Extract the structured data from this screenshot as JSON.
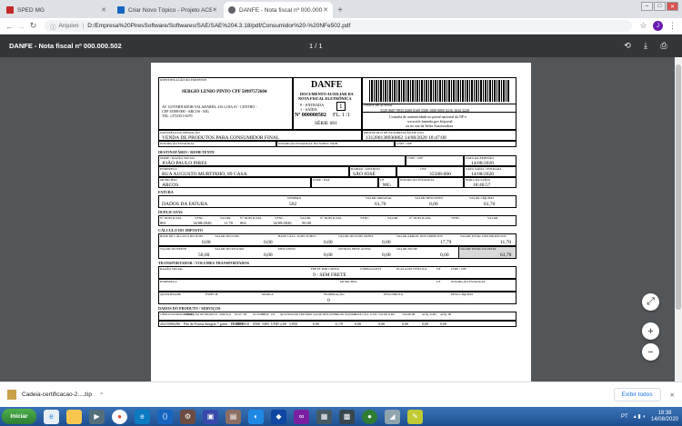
{
  "browser": {
    "tabs": [
      {
        "label": "SPED MG",
        "color": "#c62828",
        "active": false
      },
      {
        "label": "Criar Novo Tópico - Projeto ACBr",
        "color": "#1565c0",
        "active": false
      },
      {
        "label": "DANFE - Nota fiscal nº 000.000.502",
        "color": "#5f6368",
        "active": true
      }
    ],
    "new_tab": "+",
    "url_prefix": "Arquivo",
    "url": "D:/Empresa%20PiresSoftware/Softwares/SAE/SAE%204.3.18/pdf/Consumidor%20-%20NFe502.pdf",
    "avatar_letter": "J"
  },
  "pdf": {
    "title": "DANFE - Nota fiscal nº 000.000.502",
    "page_indicator": "1 / 1"
  },
  "danfe": {
    "recebemos": "IDENTIFICAÇÃO DO EMITENTE",
    "emitente_nome": "SERGIO LENIO PINTO CPF 50997572604",
    "emitente_end1": "AV. GOVERNADOR VALADARES, 416 LOJA 01 - CENTRO -",
    "emitente_end2": "CEP 35588-000 - ARCOS - MG",
    "emitente_tel": "TEL: (37)3351-6379",
    "danfe_title": "DANFE",
    "danfe_sub1": "DOCUMENTO AUXILIAR DA",
    "danfe_sub2": "NOTA FISCAL ELETRÔNICA",
    "entrada": "0 - ENTRADA",
    "saida": "1 - SAÍDA",
    "tipo": "1",
    "numero": "Nº 000000502",
    "folha": "FL. 1 /1",
    "serie": "SÉRIE 001",
    "chave_label": "CHAVE DE ACESSO",
    "chave": "3120 0607 9933 0200 0169 5500 1000 0005 0216 1634 3228",
    "consulta1": "Consulta de autenticidade no portal nacional da NF-e",
    "consulta2": "www.nfe.fazenda.gov.br/portal",
    "consulta3": "ou no site da Sefaz Autorizadora",
    "natureza_label": "NATUREZA DA OPERAÇÃO",
    "natureza": "VENDA DE PRODUTOS PARA CONSUMIDOR FINAL",
    "protocolo_label": "PROTOCOLO DE AUTORIZAÇÃO DE USO",
    "protocolo": "131200138930862 14/08/2020 18:47:00",
    "ie_label": "INSCRIÇÃO ESTADUAL",
    "ie_st_label": "INSCRIÇÃO ESTADUAL DO SUBST. TRIB.",
    "cnpj_label": "CNPJ / CPF",
    "dest_section": "DESTINATÁRIO / REMETENTE",
    "dest_nome_label": "NOME / RAZÃO SOCIAL",
    "dest_nome": "JOÃO PAULO PIRES",
    "dest_cnpj_label": "CNPJ / CPF",
    "dest_emissao_label": "DATA DA EMISSÃO",
    "dest_emissao": "14/08/2020",
    "dest_end_label": "ENDEREÇO",
    "dest_end": "RUA AUGUSTO MURTINHO, 89 CASA",
    "dest_bairro_label": "BAIRRO / DISTRITO",
    "dest_bairro": "SÃO JOSÉ",
    "dest_cep_label": "CEP",
    "dest_cep": "35588-000",
    "dest_saida_label": "DATA SAÍDA / ENTRADA",
    "dest_saida": "14/08/2020",
    "dest_mun_label": "MUNICÍPIO",
    "dest_mun": "ARCOS",
    "dest_fone_label": "FONE / FAX",
    "dest_uf_label": "UF",
    "dest_uf": "MG",
    "dest_ie_label": "INSCRIÇÃO ESTADUAL",
    "dest_hora_label": "HORA DA SAÍDA",
    "dest_hora": "18:46:57",
    "fatura_section": "FATURA",
    "fat_headers": [
      "NÚMERO",
      "VALOR ORIGINAL",
      "VALOR DESCONTO",
      "VALOR LÍQUIDO"
    ],
    "fat_desc": "DADOS DA FATURA",
    "fat_values": [
      "502",
      "61,70",
      "0,00",
      "61,70"
    ],
    "dup_section": "DUPLICATAS",
    "dup_headers": [
      "Nº DUPLICATA",
      "VENC.",
      "VALOR",
      "Nº DUPLICATA",
      "VENC.",
      "VALOR",
      "Nº DUPLICATA",
      "VENC.",
      "VALOR",
      "Nº DUPLICATA",
      "VENC.",
      "VALOR"
    ],
    "dup_values": [
      "001",
      "14/08/2020",
      "11,70",
      "002",
      "14/09/2020",
      "50,00"
    ],
    "imposto_section": "CÁLCULO DO IMPOSTO",
    "imp_headers1": [
      "BASE DE CÁLCULO DO ICMS",
      "VALOR DO ICMS",
      "BASE CÁLC. ICMS SUBST.",
      "VALOR DO ICMS SUBST.",
      "VALOR APROX. DOS TRIBUTOS",
      "VALOR TOTAL DOS PRODUTOS"
    ],
    "imp_values1": [
      "0,00",
      "0,00",
      "0,00",
      "0,00",
      "17,79",
      "11,70"
    ],
    "imp_headers2": [
      "VALOR DO FRETE",
      "VALOR DO SEGURO",
      "DESCONTO",
      "OUTRAS DESP. ACESS.",
      "VALOR DO IPI",
      "VALOR TOTAL DA NOTA"
    ],
    "imp_values2": [
      "50,00",
      "0,00",
      "0,00",
      "0,00",
      "0,00",
      "61,70"
    ],
    "transp_section": "TRANSPORTADOR / VOLUMES TRANSPORTADOS",
    "transp_headers": [
      "RAZÃO SOCIAL",
      "FRETE POR CONTA",
      "CÓDIGO ANTT",
      "PLACA DO VEÍCULO",
      "UF",
      "CNPJ / CPF"
    ],
    "transp_frete": "9 - SEM FRETE",
    "transp_row2": [
      "ENDEREÇO",
      "MUNICÍPIO",
      "UF",
      "INSCRIÇÃO ESTADUAL"
    ],
    "transp_row3": [
      "QUANTIDADE",
      "ESPÉCIE",
      "MARCA",
      "NUMERAÇÃO",
      "PESO BRUTO",
      "PESO LÍQUIDO"
    ],
    "transp_num": "0",
    "prod_section": "DADOS DO PRODUTO / SERVIÇOS",
    "prod_headers": [
      "CÓDIGO DO PROD. / SERV.",
      "DESCRIÇÃO DO PRODUTO / SERVIÇO",
      "NCM / SH",
      "O/CSOSN",
      "CFOP",
      "UN",
      "QUANT.",
      "VALOR UNITÁRIO",
      "VALOR DESCONTO",
      "VALOR LÍQUIDO",
      "BASE CÁLC ICMS",
      "VALOR ICMS",
      "VALOR IPI",
      "ALÍQ. ICMS",
      "ALÍQ. IPI"
    ],
    "prod_row": [
      "20215000206",
      "Pão de Forma Integral 7 grãos - PRADO",
      "19059010",
      "0500",
      "5405",
      "UND",
      "2,00",
      "5,850",
      "0,00",
      "11,70",
      "0,00",
      "0,00",
      "0,00",
      "0,00",
      "0,00"
    ]
  },
  "download": {
    "file": "Cadeia-certificacao-2....zip",
    "show_all": "Exibir todos"
  },
  "taskbar": {
    "start": "Iniciar",
    "lang": "PT",
    "time": "19:38",
    "date": "14/08/2020"
  }
}
